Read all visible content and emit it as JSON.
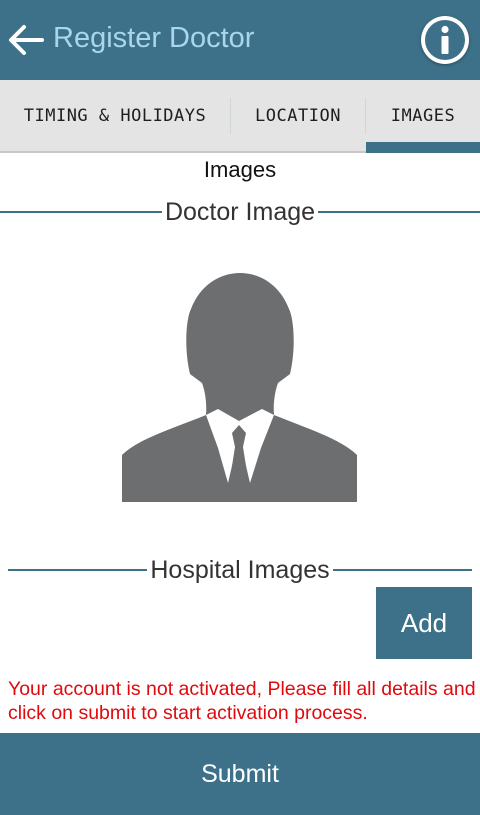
{
  "app_bar": {
    "title": "Register Doctor",
    "back_icon": "arrow-left-icon",
    "info_icon": "info-icon",
    "color": "#3d7189",
    "title_color": "#a9d6ec"
  },
  "tabs": [
    {
      "label": "TIMING & HOLIDAYS",
      "selected": false
    },
    {
      "label": "LOCATION",
      "selected": false
    },
    {
      "label": "IMAGES",
      "selected": true
    }
  ],
  "content": {
    "page_caption": "Images",
    "doctor_section": {
      "title": "Doctor Image",
      "placeholder_icon": "person-silhouette-icon"
    },
    "hospital_section": {
      "title": "Hospital Images",
      "add_label": "Add"
    },
    "warning": "Your account is not activated, Please fill all details and click on submit to start activation process.",
    "warning_color": "#e0090e"
  },
  "footer": {
    "submit_label": "Submit"
  }
}
